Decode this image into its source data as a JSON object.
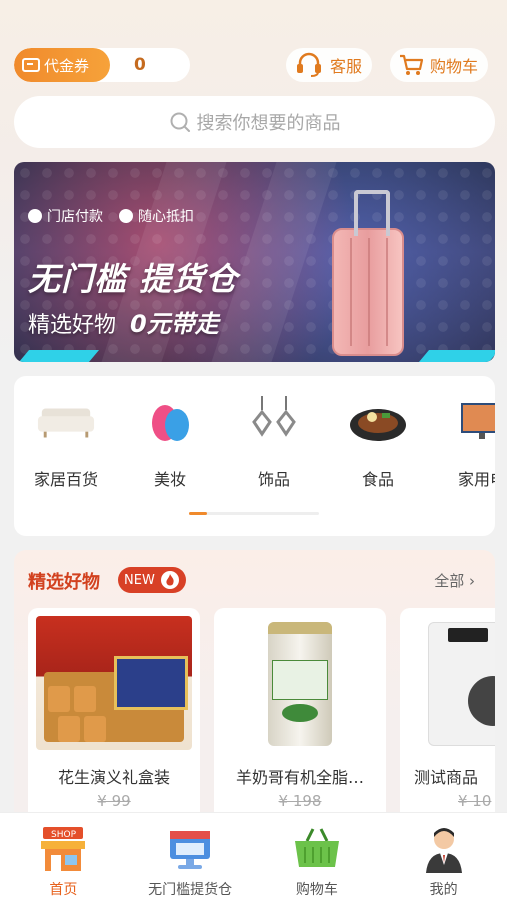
{
  "top": {
    "voucher_label": "代金券",
    "voucher_count": "0",
    "service_label": "客服",
    "cart_label": "购物车"
  },
  "search": {
    "placeholder": "搜索你想要的商品"
  },
  "banner": {
    "tag1": "门店付款",
    "tag2": "随心抵扣",
    "title": "无门槛 提货仓",
    "subtitle": "精选好物",
    "subtitle_highlight": "0元带走"
  },
  "categories": [
    {
      "label": "家居百货",
      "icon": "sofa-icon"
    },
    {
      "label": "美妆",
      "icon": "makeup-sponge-icon"
    },
    {
      "label": "饰品",
      "icon": "earrings-icon"
    },
    {
      "label": "食品",
      "icon": "food-plate-icon"
    },
    {
      "label": "家用电",
      "icon": "tv-icon"
    }
  ],
  "featured": {
    "title": "精选好物",
    "badge": "NEW",
    "more": "全部",
    "products": [
      {
        "name": "花生演义礼盒装",
        "price": "¥ 99"
      },
      {
        "name": "羊奶哥有机全脂…",
        "price": "¥ 198"
      },
      {
        "name": "测试商品",
        "price": "¥ 10"
      }
    ]
  },
  "tabbar": [
    {
      "label": "首页",
      "active": true
    },
    {
      "label": "无门槛提货仓",
      "active": false
    },
    {
      "label": "购物车",
      "active": false
    },
    {
      "label": "我的",
      "active": false
    }
  ],
  "colors": {
    "accent": "#f08a2c",
    "brand_red": "#d2411f",
    "active_tab": "#e7611c"
  }
}
